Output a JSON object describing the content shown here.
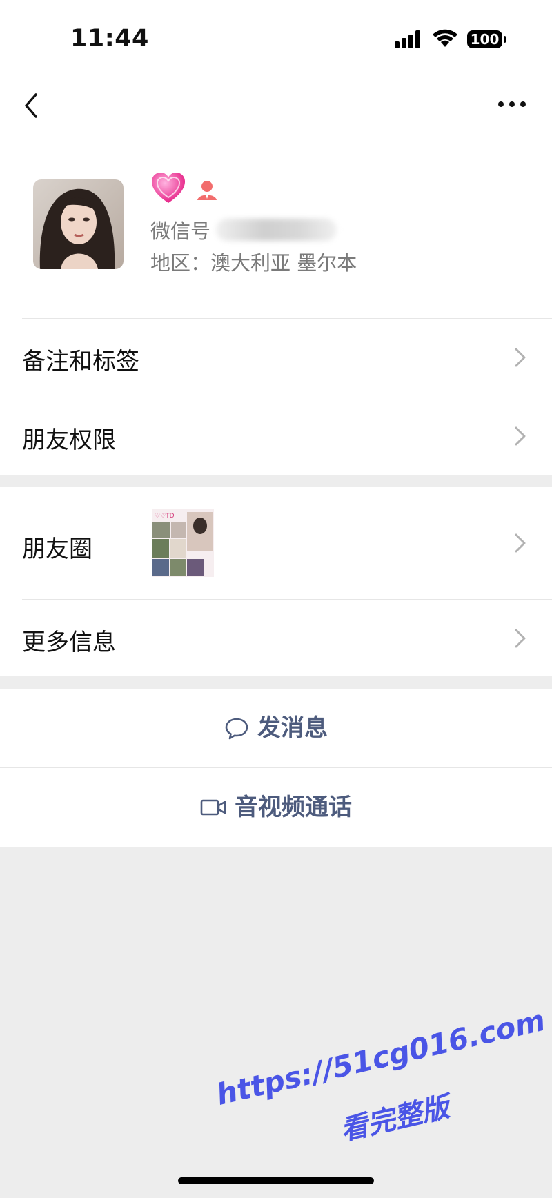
{
  "status_bar": {
    "time": "11:44",
    "battery": "100"
  },
  "profile": {
    "wechat_id_label": "微信号",
    "region": "地区：澳大利亚 墨尔本"
  },
  "rows": {
    "remarks_tags": "备注和标签",
    "friend_permissions": "朋友权限",
    "moments": "朋友圈",
    "more_info": "更多信息"
  },
  "actions": {
    "send_message": "发消息",
    "video_call": "音视频通话"
  },
  "watermark": {
    "url": "https://51cg016.com",
    "text": "看完整版"
  },
  "colors": {
    "action_text": "#4d5b7d",
    "background": "#ededed",
    "watermark": "#4a55e6"
  }
}
